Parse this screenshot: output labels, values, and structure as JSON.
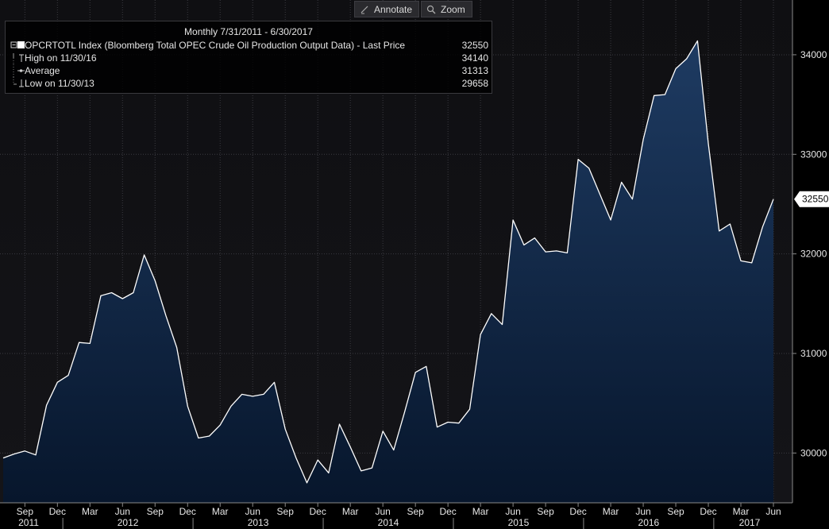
{
  "toolbar": {
    "annotate_label": "Annotate",
    "zoom_label": "Zoom"
  },
  "legend": {
    "title": "Monthly 7/31/2011 - 6/30/2017",
    "rows": [
      {
        "label": "OPCRTOTL Index (Bloomberg Total OPEC Crude Oil Production Output Data) - Last Price",
        "value": "32550"
      },
      {
        "label": "High on 11/30/16",
        "value": "34140"
      },
      {
        "label": "Average",
        "value": "31313"
      },
      {
        "label": "Low on 11/30/13",
        "value": "29658"
      }
    ]
  },
  "last_price_tag": "32550",
  "colors": {
    "background": "#000000",
    "plot_top": "#0f0f12",
    "area_top": "#1e3b62",
    "area_bottom": "#07162c",
    "line": "#ffffff",
    "grid": "#3a3a40",
    "tag_bg": "#ffffff",
    "tag_text": "#000000",
    "axis_text": "#e6e6e6"
  },
  "chart_data": {
    "type": "area",
    "title": "Monthly 7/31/2011 - 6/30/2017",
    "series": [
      {
        "name": "OPCRTOTL Index (Bloomberg Total OPEC Crude Oil Production Output Data) - Last Price",
        "start": "2011-07",
        "frequency": "monthly",
        "values": [
          29950,
          29990,
          30020,
          29980,
          30480,
          30710,
          30780,
          31110,
          31100,
          31580,
          31610,
          31550,
          31610,
          31990,
          31730,
          31380,
          31060,
          30470,
          30150,
          30170,
          30280,
          30470,
          30590,
          30570,
          30590,
          30710,
          30240,
          29950,
          29700,
          29930,
          29800,
          30290,
          30060,
          29820,
          29850,
          30220,
          30030,
          30410,
          30810,
          30870,
          30260,
          30310,
          30300,
          30440,
          31190,
          31400,
          31290,
          32340,
          32090,
          32160,
          32020,
          32030,
          32010,
          32950,
          32860,
          32600,
          32340,
          32720,
          32550,
          33150,
          33590,
          33600,
          33860,
          33960,
          34140,
          33110,
          32230,
          32300,
          31930,
          31910,
          32270,
          32550
        ]
      }
    ],
    "summary": {
      "last": 32550,
      "high": 34140,
      "high_date": "11/30/16",
      "average": 31313,
      "low": 29658,
      "low_date": "11/30/13"
    },
    "ylim": [
      29500,
      34550
    ],
    "yticks": [
      30000,
      31000,
      32000,
      33000,
      34000
    ],
    "x_month_ticks": [
      {
        "month": "2011-09",
        "label": "Sep"
      },
      {
        "month": "2011-12",
        "label": "Dec"
      },
      {
        "month": "2012-03",
        "label": "Mar"
      },
      {
        "month": "2012-06",
        "label": "Jun"
      },
      {
        "month": "2012-09",
        "label": "Sep"
      },
      {
        "month": "2012-12",
        "label": "Dec"
      },
      {
        "month": "2013-03",
        "label": "Mar"
      },
      {
        "month": "2013-06",
        "label": "Jun"
      },
      {
        "month": "2013-09",
        "label": "Sep"
      },
      {
        "month": "2013-12",
        "label": "Dec"
      },
      {
        "month": "2014-03",
        "label": "Mar"
      },
      {
        "month": "2014-06",
        "label": "Jun"
      },
      {
        "month": "2014-09",
        "label": "Sep"
      },
      {
        "month": "2014-12",
        "label": "Dec"
      },
      {
        "month": "2015-03",
        "label": "Mar"
      },
      {
        "month": "2015-06",
        "label": "Jun"
      },
      {
        "month": "2015-09",
        "label": "Sep"
      },
      {
        "month": "2015-12",
        "label": "Dec"
      },
      {
        "month": "2016-03",
        "label": "Mar"
      },
      {
        "month": "2016-06",
        "label": "Jun"
      },
      {
        "month": "2016-09",
        "label": "Sep"
      },
      {
        "month": "2016-12",
        "label": "Dec"
      },
      {
        "month": "2017-03",
        "label": "Mar"
      },
      {
        "month": "2017-06",
        "label": "Jun"
      }
    ],
    "x_years": [
      "2011",
      "2012",
      "2013",
      "2014",
      "2015",
      "2016",
      "2017"
    ],
    "grid": true,
    "legend_position": "top-left",
    "y_axis_position": "right"
  }
}
